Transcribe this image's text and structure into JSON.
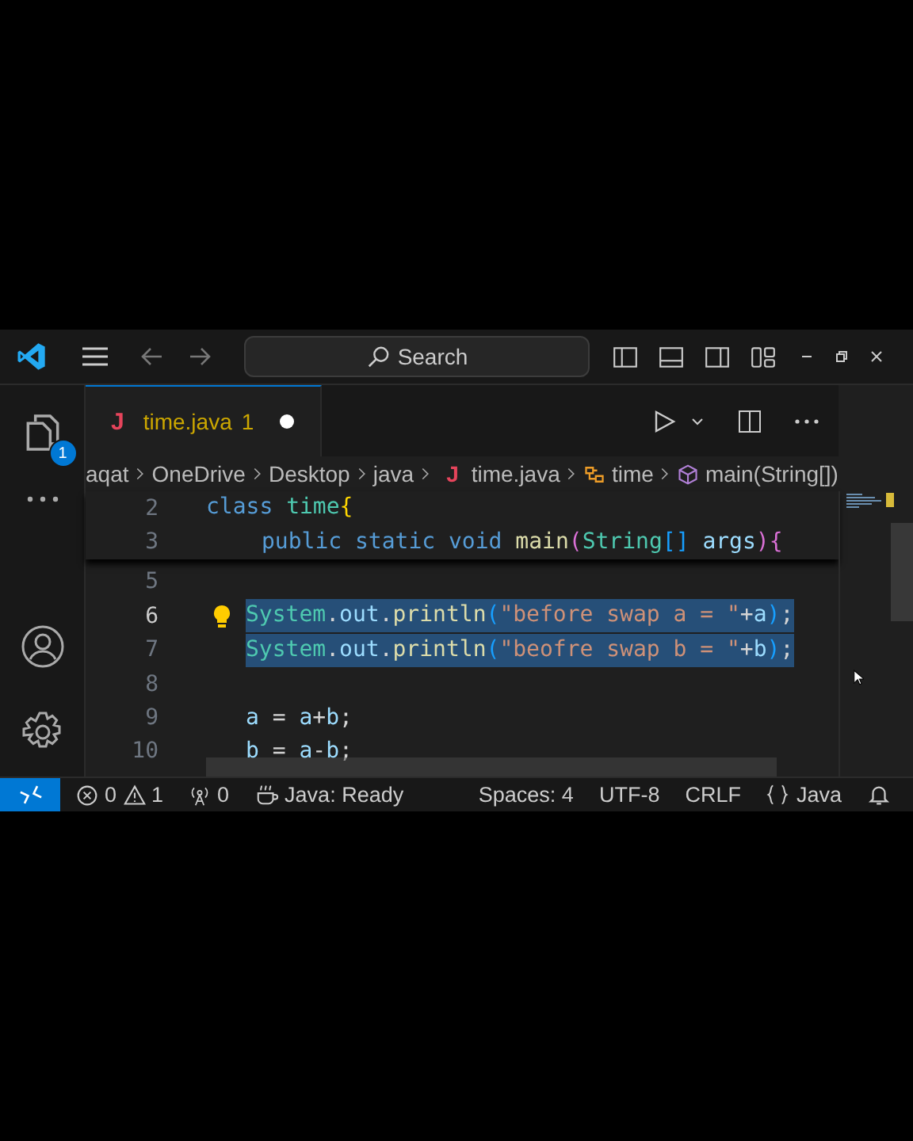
{
  "title_bar": {
    "search": {
      "label": "Search"
    }
  },
  "activity_bar": {
    "explorer_badge": "1"
  },
  "tabs": [
    {
      "icon_letter": "J",
      "label": "time.java",
      "problems": "1",
      "modified": true,
      "selected": true
    }
  ],
  "breadcrumbs": [
    {
      "label": "aqat",
      "kind": "folder"
    },
    {
      "label": "OneDrive",
      "kind": "folder"
    },
    {
      "label": "Desktop",
      "kind": "folder"
    },
    {
      "label": "java",
      "kind": "folder"
    },
    {
      "label": "time.java",
      "kind": "file",
      "icon_letter": "J"
    },
    {
      "label": "time",
      "kind": "class"
    },
    {
      "label": "main(String[])",
      "kind": "method"
    }
  ],
  "editor": {
    "sticky_lines": [
      {
        "number": "2",
        "kind": "class",
        "tokens": [
          {
            "text": "class ",
            "kind": "keyword"
          },
          {
            "text": "time",
            "kind": "type"
          },
          {
            "text": "{",
            "kind": "brace-gold"
          }
        ]
      },
      {
        "number": "3",
        "kind": "method",
        "tokens": [
          {
            "text": "public static void ",
            "kind": "keyword"
          },
          {
            "text": "main",
            "kind": "function"
          },
          {
            "text": "(",
            "kind": "brace-pink"
          },
          {
            "text": "String",
            "kind": "type"
          },
          {
            "text": "[] ",
            "kind": "brace-blue"
          },
          {
            "text": "args",
            "kind": "variable"
          },
          {
            "text": "){",
            "kind": "brace-pink"
          }
        ]
      }
    ],
    "lines": [
      {
        "number": "5",
        "kind": "statement",
        "selected": false,
        "current": false,
        "lightbulb": false
      },
      {
        "number": "6",
        "kind": "statement",
        "selected": true,
        "current": true,
        "lightbulb": true,
        "tokens": [
          {
            "text": "System",
            "kind": "type"
          },
          {
            "text": ".",
            "kind": "punct"
          },
          {
            "text": "out",
            "kind": "variable"
          },
          {
            "text": ".",
            "kind": "punct"
          },
          {
            "text": "println",
            "kind": "function"
          },
          {
            "text": "(",
            "kind": "brace-blue"
          },
          {
            "text": "\"before swap a = \"",
            "kind": "string"
          },
          {
            "text": "+",
            "kind": "punct"
          },
          {
            "text": "a",
            "kind": "variable"
          },
          {
            "text": ")",
            "kind": "brace-blue"
          },
          {
            "text": ";",
            "kind": "punct"
          }
        ]
      },
      {
        "number": "7",
        "kind": "statement",
        "selected": true,
        "current": false,
        "lightbulb": false,
        "tokens": [
          {
            "text": "System",
            "kind": "type"
          },
          {
            "text": ".",
            "kind": "punct"
          },
          {
            "text": "out",
            "kind": "variable"
          },
          {
            "text": ".",
            "kind": "punct"
          },
          {
            "text": "println",
            "kind": "function"
          },
          {
            "text": "(",
            "kind": "brace-blue"
          },
          {
            "text": "\"beofre swap b = \"",
            "kind": "string"
          },
          {
            "text": "+",
            "kind": "punct"
          },
          {
            "text": "b",
            "kind": "variable"
          },
          {
            "text": ")",
            "kind": "brace-blue"
          },
          {
            "text": ";",
            "kind": "punct"
          }
        ]
      },
      {
        "number": "8",
        "kind": "statement",
        "selected": false,
        "current": false,
        "lightbulb": false
      },
      {
        "number": "9",
        "kind": "statement",
        "selected": false,
        "current": false,
        "lightbulb": false,
        "tokens": [
          {
            "text": "a",
            "kind": "variable"
          },
          {
            "text": " = ",
            "kind": "punct"
          },
          {
            "text": "a",
            "kind": "variable"
          },
          {
            "text": "+",
            "kind": "punct"
          },
          {
            "text": "b",
            "kind": "variable"
          },
          {
            "text": ";",
            "kind": "punct"
          }
        ]
      },
      {
        "number": "10",
        "kind": "statement",
        "selected": false,
        "current": false,
        "lightbulb": false,
        "tokens": [
          {
            "text": "b",
            "kind": "variable"
          },
          {
            "text": " = ",
            "kind": "punct"
          },
          {
            "text": "a",
            "kind": "variable"
          },
          {
            "text": "-",
            "kind": "punct"
          },
          {
            "text": "b",
            "kind": "variable"
          },
          {
            "text": ";",
            "kind": "punct"
          }
        ]
      }
    ]
  },
  "status_bar": {
    "errors": "0",
    "warnings": "1",
    "ports": "0",
    "java_status": "Java: Ready",
    "indentation": "Spaces: 4",
    "encoding": "UTF-8",
    "line_ending": "CRLF",
    "language": "Java"
  }
}
